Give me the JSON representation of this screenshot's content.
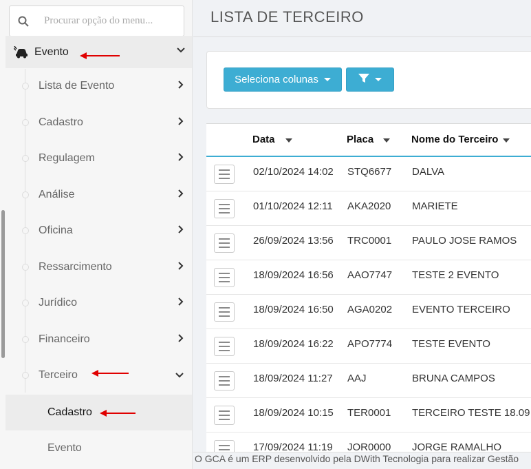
{
  "search": {
    "placeholder": "Procurar opção do menu..."
  },
  "sidebar": {
    "top_item": {
      "label": "Evento",
      "icon": "car-crash-icon"
    },
    "items": [
      {
        "label": "Lista de Evento"
      },
      {
        "label": "Cadastro"
      },
      {
        "label": "Regulagem"
      },
      {
        "label": "Análise"
      },
      {
        "label": "Oficina"
      },
      {
        "label": "Ressarcimento"
      },
      {
        "label": "Jurídico"
      },
      {
        "label": "Financeiro"
      },
      {
        "label": "Terceiro"
      }
    ],
    "sub_items": [
      {
        "label": "Cadastro"
      },
      {
        "label": "Evento"
      }
    ]
  },
  "page": {
    "title": "LISTA DE TERCEIRO"
  },
  "toolbar": {
    "columns_button": "Seleciona colunas"
  },
  "table": {
    "headers": [
      "Data",
      "Placa",
      "Nome do Terceiro"
    ],
    "rows": [
      {
        "data": "02/10/2024 14:02",
        "placa": "STQ6677",
        "nome": "DALVA"
      },
      {
        "data": "01/10/2024 12:11",
        "placa": "AKA2020",
        "nome": "MARIETE"
      },
      {
        "data": "26/09/2024 13:56",
        "placa": "TRC0001",
        "nome": "PAULO JOSE RAMOS"
      },
      {
        "data": "18/09/2024 16:56",
        "placa": "AAO7747",
        "nome": "TESTE 2 EVENTO"
      },
      {
        "data": "18/09/2024 16:50",
        "placa": "AGA0202",
        "nome": "EVENTO TERCEIRO"
      },
      {
        "data": "18/09/2024 16:22",
        "placa": "APO7774",
        "nome": "TESTE EVENTO"
      },
      {
        "data": "18/09/2024 11:27",
        "placa": "AAJ",
        "nome": "BRUNA CAMPOS"
      },
      {
        "data": "18/09/2024 10:15",
        "placa": "TER0001",
        "nome": "TERCEIRO TESTE 18.09"
      },
      {
        "data": "17/09/2024 11:19",
        "placa": "JOR0000",
        "nome": "JORGE RAMALHO"
      }
    ]
  },
  "footer": {
    "text": "O GCA é um ERP desenvolvido pela DWith Tecnologia para realizar Gestão"
  },
  "colors": {
    "accent": "#3dadd3",
    "annotation_arrow": "#e00000"
  }
}
